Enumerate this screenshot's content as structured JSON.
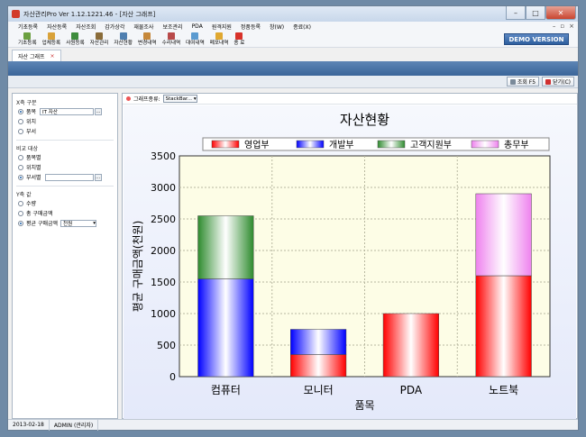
{
  "window": {
    "title": "자산관리Pro Ver 1.12.1221.46 - [자산 그래프]"
  },
  "menu": [
    "기초등록",
    "자산등록",
    "자산조회",
    "감가상각",
    "재물조사",
    "보조관리",
    "PDA",
    "원격지원",
    "정품등록",
    "창(W)",
    "종료(X)"
  ],
  "toolbar": [
    "기초등록",
    "업체등록",
    "사원등록",
    "자산관리",
    "자산현황",
    "변경내역",
    "수리내역",
    "대여내역",
    "폐포내역",
    "종 료"
  ],
  "demo_label": "DEMO VERSION",
  "tab_label": "자산 그래프",
  "tab_close": "×",
  "actions": {
    "search": "조회 F5",
    "close": "닫기(C)"
  },
  "left": {
    "xaxis_title": "X축 구분",
    "xaxis_opts": [
      "품목",
      "위치",
      "부서"
    ],
    "xaxis_value": "IT 자산",
    "compare_title": "비교 대상",
    "compare_opts": [
      "품목별",
      "위치별",
      "부서별"
    ],
    "yaxis_title": "Y축 값",
    "yaxis_opts": [
      "수량",
      "총 구매금액",
      "평균 구매금액"
    ],
    "unit_value": "천원"
  },
  "graph_type": {
    "label": "그래프종류:",
    "value": "StackBar..."
  },
  "status": {
    "date": "2013-02-18",
    "user": "ADMIN (관리자)"
  },
  "chart_data": {
    "type": "bar",
    "title": "자산현황",
    "xlabel": "품목",
    "ylabel": "평균 구매금액(천원)",
    "ylim": [
      0,
      3500
    ],
    "yticks": [
      0,
      500,
      1000,
      1500,
      2000,
      2500,
      3000,
      3500
    ],
    "categories": [
      "컴퓨터",
      "모니터",
      "PDA",
      "노트북"
    ],
    "series": [
      {
        "name": "영업부",
        "values": [
          0,
          350,
          1000,
          1600
        ],
        "color": "#ff0000"
      },
      {
        "name": "개발부",
        "values": [
          1550,
          400,
          0,
          0
        ],
        "color": "#0000ff"
      },
      {
        "name": "고객지원부",
        "values": [
          1000,
          0,
          0,
          0
        ],
        "color": "#2e8b2e"
      },
      {
        "name": "총무부",
        "values": [
          0,
          0,
          0,
          1300
        ],
        "color": "#ee82ee"
      }
    ],
    "legend": "top",
    "grid": true
  }
}
